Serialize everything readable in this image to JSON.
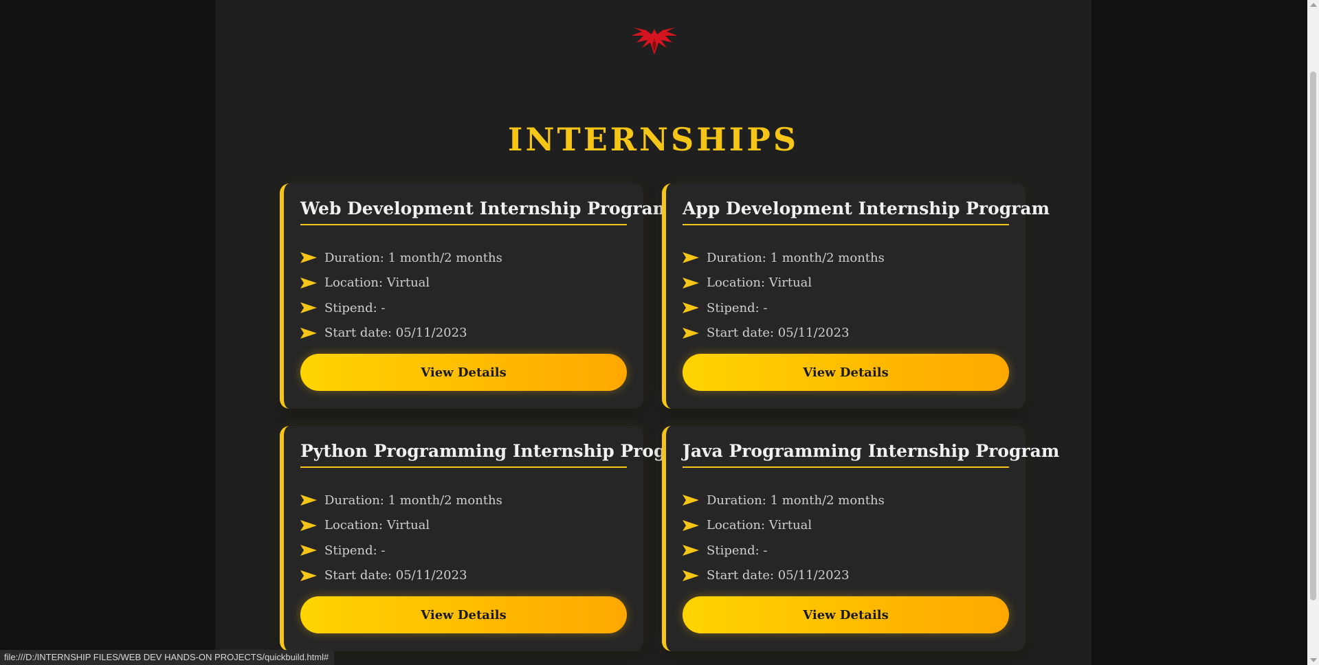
{
  "page": {
    "heading": "INTERNSHIPS"
  },
  "logo": {
    "icon": "phoenix-wings-logo",
    "color": "#d4141e"
  },
  "colors": {
    "accent": "#f5c518",
    "button_gradient_start": "#ffd400",
    "button_gradient_end": "#ffa800",
    "card_background": "#262626",
    "page_background": "#1f1f1f"
  },
  "cards": [
    {
      "title": "Web Development Internship Program",
      "duration": "Duration: 1 month/2 months",
      "location": "Location: Virtual",
      "stipend": "Stipend: -",
      "start_date": "Start date: 05/11/2023",
      "button_label": "View Details"
    },
    {
      "title": "App Development Internship Program",
      "duration": "Duration: 1 month/2 months",
      "location": "Location: Virtual",
      "stipend": "Stipend: -",
      "start_date": "Start date: 05/11/2023",
      "button_label": "View Details"
    },
    {
      "title": "Python Programming Internship Program",
      "duration": "Duration: 1 month/2 months",
      "location": "Location: Virtual",
      "stipend": "Stipend: -",
      "start_date": "Start date: 05/11/2023",
      "button_label": "View Details"
    },
    {
      "title": "Java Programming Internship Program",
      "duration": "Duration: 1 month/2 months",
      "location": "Location: Virtual",
      "stipend": "Stipend: -",
      "start_date": "Start date: 05/11/2023",
      "button_label": "View Details"
    }
  ],
  "status_bar": {
    "url": "file:///D:/INTERNSHIP FILES/WEB DEV HANDS-ON PROJECTS/quickbuild.html#"
  }
}
